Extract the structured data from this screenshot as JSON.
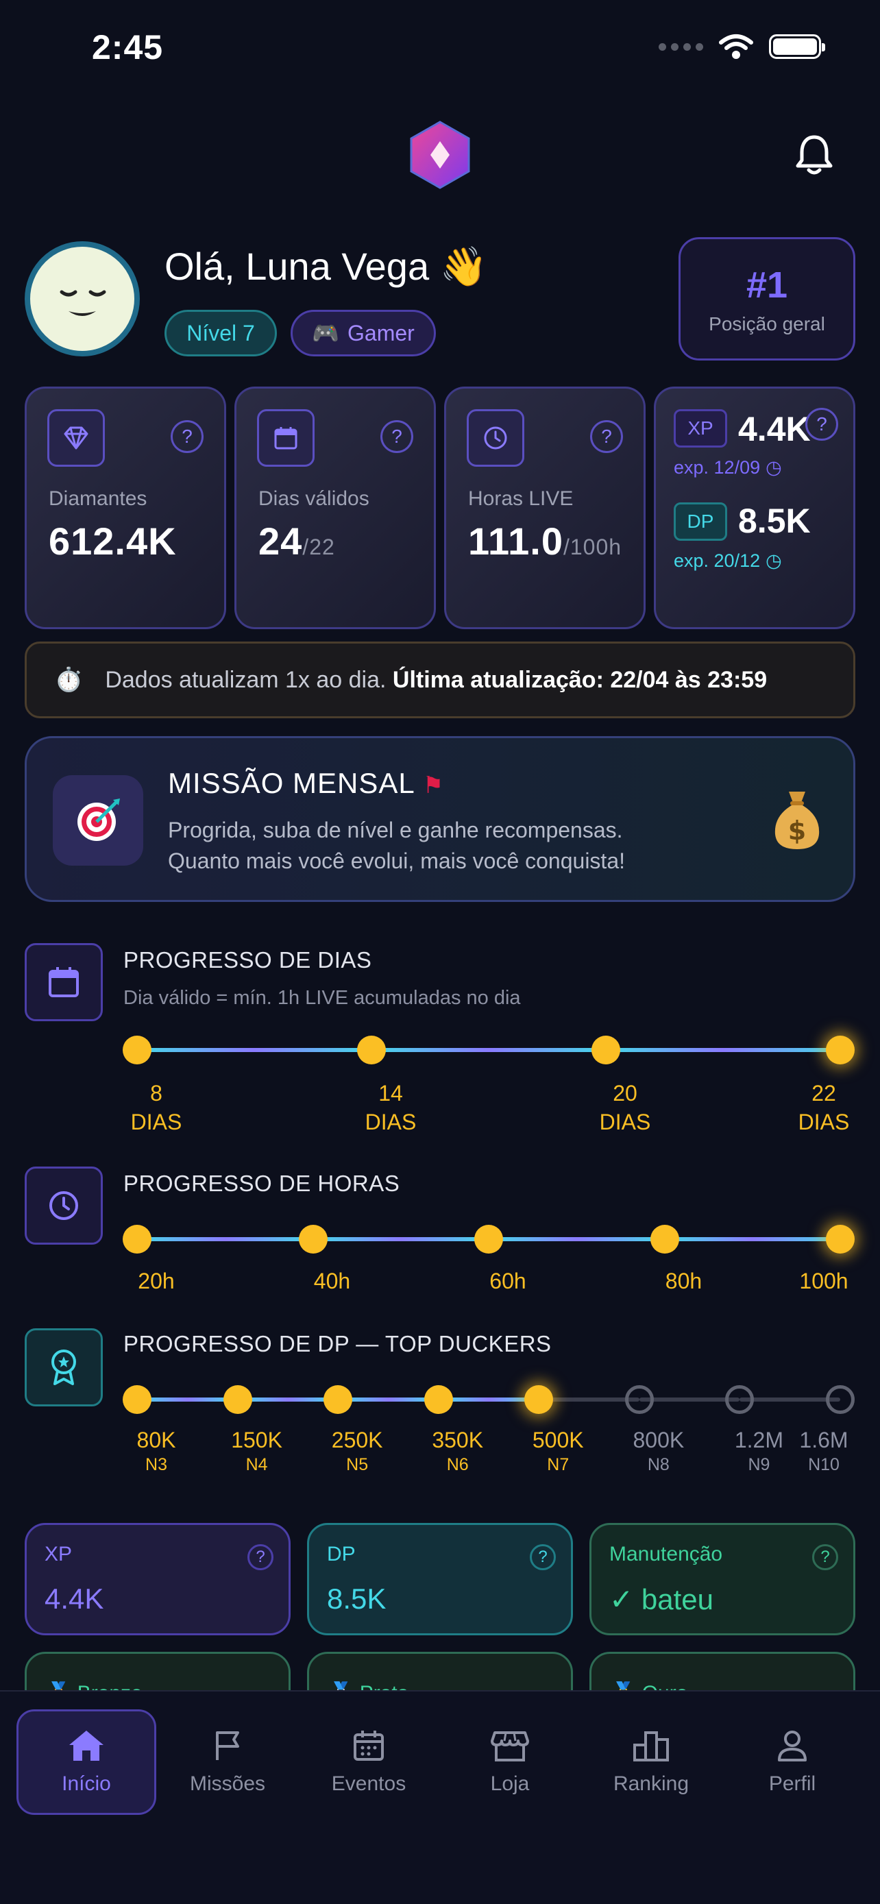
{
  "status_bar": {
    "time": "2:45"
  },
  "header": {
    "logo_icon": "diamond-logo-icon",
    "bell_icon": "bell-icon"
  },
  "profile": {
    "greeting": "Olá, Luna Vega 👋",
    "level_chip": "Nível 7",
    "role_chip": "Gamer",
    "rank_value": "#1",
    "rank_label": "Posição geral"
  },
  "stats": [
    {
      "label": "Diamantes",
      "value": "612.4K",
      "suffix": "",
      "icon": "diamond-icon"
    },
    {
      "label": "Dias válidos",
      "value": "24",
      "suffix": "/22",
      "icon": "calendar-icon"
    },
    {
      "label": "Horas LIVE",
      "value": "111.0",
      "suffix": "/100h",
      "icon": "clock-icon"
    }
  ],
  "xp_dp_card": {
    "xp_tag": "XP",
    "xp_value": "4.4K",
    "xp_exp": "exp. 12/09",
    "dp_tag": "DP",
    "dp_value": "8.5K",
    "dp_exp": "exp. 20/12"
  },
  "help_mark": "?",
  "notice": {
    "text": "Dados atualizam 1x ao dia.",
    "bold": "Última atualização: 22/04 às 23:59"
  },
  "mission": {
    "title": "MISSÃO MENSAL",
    "line1": "Progrida, suba de nível e ganhe recompensas.",
    "line2": "Quanto mais você evolui, mais você conquista!"
  },
  "days_progress": {
    "title": "PROGRESSO DE DIAS",
    "subtitle": "Dia válido = mín. 1h LIVE acumuladas no dia",
    "milestones": [
      {
        "value": "8",
        "unit": "DIAS",
        "reached": true
      },
      {
        "value": "14",
        "unit": "DIAS",
        "reached": true
      },
      {
        "value": "20",
        "unit": "DIAS",
        "reached": true
      },
      {
        "value": "22",
        "unit": "DIAS",
        "reached": true
      }
    ]
  },
  "hours_progress": {
    "title": "PROGRESSO DE HORAS",
    "milestones": [
      {
        "value": "20h",
        "reached": true
      },
      {
        "value": "40h",
        "reached": true
      },
      {
        "value": "60h",
        "reached": true
      },
      {
        "value": "80h",
        "reached": true
      },
      {
        "value": "100h",
        "reached": true
      }
    ]
  },
  "dp_progress": {
    "title": "PROGRESSO DE DP — TOP DUCKERS",
    "milestones": [
      {
        "value": "80K",
        "level": "N3",
        "reached": true
      },
      {
        "value": "150K",
        "level": "N4",
        "reached": true
      },
      {
        "value": "250K",
        "level": "N5",
        "reached": true
      },
      {
        "value": "350K",
        "level": "N6",
        "reached": true
      },
      {
        "value": "500K",
        "level": "N7",
        "reached": true
      },
      {
        "value": "800K",
        "level": "N8",
        "reached": false
      },
      {
        "value": "1.2M",
        "level": "N9",
        "reached": false
      },
      {
        "value": "1.6M",
        "level": "N10",
        "reached": false
      }
    ]
  },
  "mini_cards": [
    {
      "label": "XP",
      "value": "4.4K"
    },
    {
      "label": "DP",
      "value": "8.5K"
    },
    {
      "label": "Manutenção",
      "value": "✓ bateu"
    }
  ],
  "medal_cards": [
    "🥉 Bronze",
    "🥈 Prata",
    "🥇 Ouro"
  ],
  "tabs": [
    {
      "label": "Início",
      "icon": "home-icon"
    },
    {
      "label": "Missões",
      "icon": "flag-icon"
    },
    {
      "label": "Eventos",
      "icon": "calendar-icon"
    },
    {
      "label": "Loja",
      "icon": "store-icon"
    },
    {
      "label": "Ranking",
      "icon": "ranking-icon"
    },
    {
      "label": "Perfil",
      "icon": "user-icon"
    }
  ],
  "colors": {
    "accent": "#8b7bff",
    "cyan": "#44d9e8",
    "gold": "#fbbf24",
    "green": "#3fd39c",
    "background": "#0c0f1c"
  }
}
